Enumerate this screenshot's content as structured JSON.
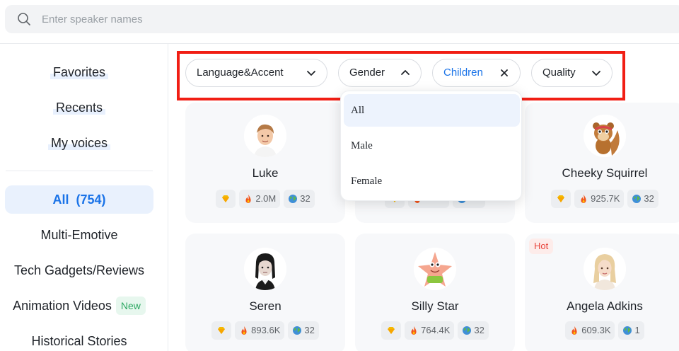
{
  "search": {
    "placeholder": "Enter speaker names"
  },
  "sidebar": {
    "top_items": [
      "Favorites",
      "Recents",
      "My voices"
    ],
    "all_label": "All",
    "all_count": "(754)",
    "categories": [
      "Multi-Emotive",
      "Tech Gadgets/Reviews",
      "Animation Videos",
      "Historical Stories"
    ],
    "new_badge": "New"
  },
  "filters": [
    {
      "label": "Language&Accent",
      "icon": "chevron-down-icon"
    },
    {
      "label": "Gender",
      "icon": "chevron-up-icon"
    },
    {
      "label": "Children",
      "icon": "close-icon",
      "active": true
    },
    {
      "label": "Quality",
      "icon": "chevron-down-icon"
    }
  ],
  "gender_dropdown": {
    "options": [
      "All",
      "Male",
      "Female"
    ],
    "selected": "All"
  },
  "voices": [
    {
      "name": "Luke",
      "plays": "2.0M",
      "languages": "32",
      "premium": true,
      "hot": false
    },
    {
      "name": "",
      "plays": "",
      "languages": "",
      "premium": true,
      "hot": false
    },
    {
      "name": "Cheeky Squirrel",
      "plays": "925.7K",
      "languages": "32",
      "premium": true,
      "hot": false
    },
    {
      "name": "Seren",
      "plays": "893.6K",
      "languages": "32",
      "premium": true,
      "hot": false
    },
    {
      "name": "Silly Star",
      "plays": "764.4K",
      "languages": "32",
      "premium": true,
      "hot": false
    },
    {
      "name": "Angela Adkins",
      "plays": "609.3K",
      "languages": "1",
      "premium": false,
      "hot": true,
      "hot_label": "Hot"
    }
  ],
  "colors": {
    "accent": "#1a73e8",
    "highlight_border": "#f11e14",
    "new_green": "#2ea863",
    "hot_red": "#e8453c"
  }
}
